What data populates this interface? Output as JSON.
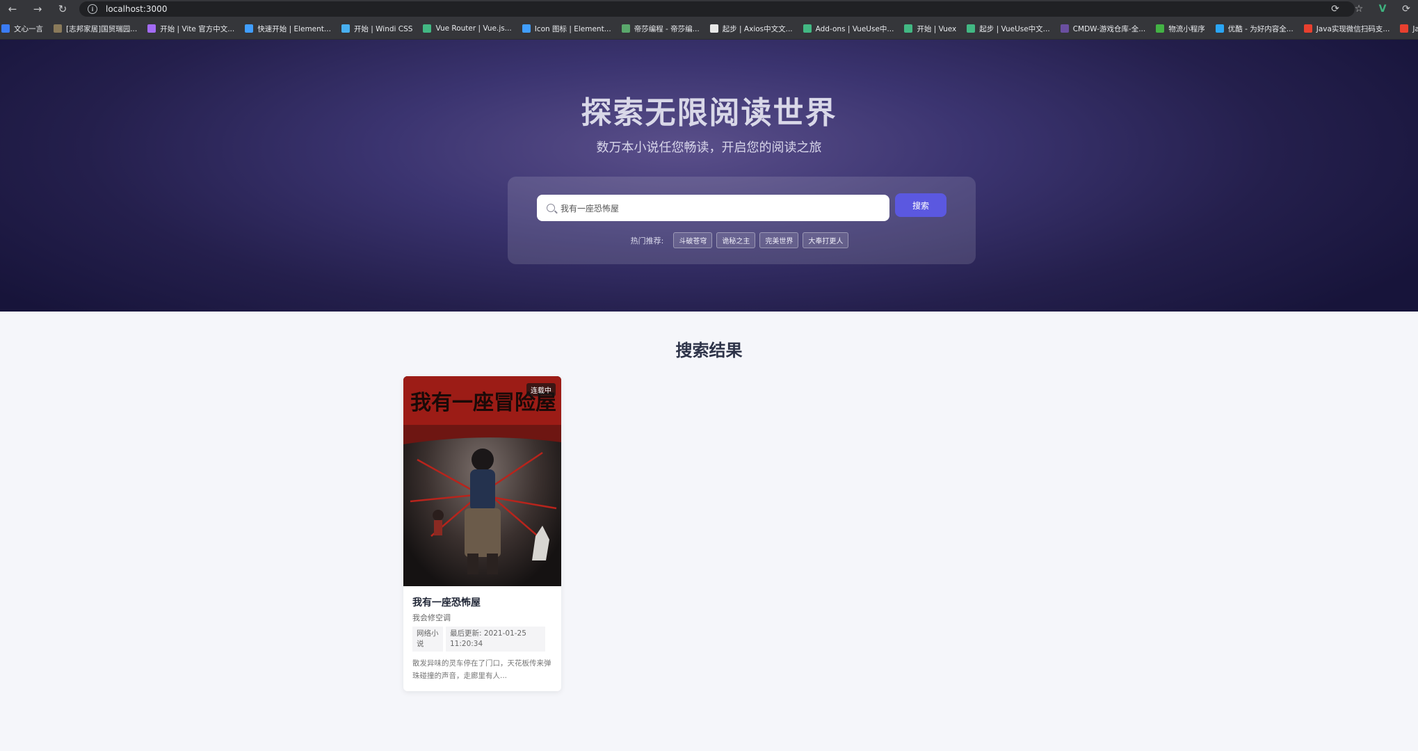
{
  "browser": {
    "url": "localhost:3000",
    "bookmarks": [
      {
        "label": "文心一言",
        "icon": "wenxin-icon",
        "color": "#3b7cf5"
      },
      {
        "label": "[志邦家居]国贸瑞园...",
        "icon": "bookmark-icon",
        "color": "#8a7a5a"
      },
      {
        "label": "开始 | Vite 官方中文...",
        "icon": "vite-icon",
        "color": "#a36bf5"
      },
      {
        "label": "快速开始 | Element...",
        "icon": "element-icon",
        "color": "#409eff"
      },
      {
        "label": "开始 | Windi CSS",
        "icon": "windi-icon",
        "color": "#48b0f1"
      },
      {
        "label": "Vue Router | Vue.js...",
        "icon": "vue-icon",
        "color": "#42b883"
      },
      {
        "label": "Icon 图标 | Element...",
        "icon": "element-icon",
        "color": "#409eff"
      },
      {
        "label": "帝莎编程 - 帝莎编...",
        "icon": "disha-icon",
        "color": "#5aa86c"
      },
      {
        "label": "起步 | Axios中文文...",
        "icon": "axios-icon",
        "color": "#e8e8e8"
      },
      {
        "label": "Add-ons | VueUse中...",
        "icon": "vueuse-icon",
        "color": "#42b883"
      },
      {
        "label": "开始 | Vuex",
        "icon": "vue-icon",
        "color": "#42b883"
      },
      {
        "label": "起步 | VueUse中文...",
        "icon": "vueuse-icon",
        "color": "#42b883"
      },
      {
        "label": "CMDW-游戏仓库-全...",
        "icon": "cmdw-icon",
        "color": "#6a4fa0"
      },
      {
        "label": "物流小程序",
        "icon": "wechat-icon",
        "color": "#43b244"
      },
      {
        "label": "优酷 - 为好内容全...",
        "icon": "youku-icon",
        "color": "#2aa5f5"
      },
      {
        "label": "Java实现微信扫码支...",
        "icon": "csdn-icon",
        "color": "#e8402f"
      },
      {
        "label": "Java--微信支付--小...",
        "icon": "csdn-icon",
        "color": "#e8402f"
      }
    ]
  },
  "hero": {
    "title": "探索无限阅读世界",
    "subtitle": "数万本小说任您畅读，开启您的阅读之旅",
    "search_value": "我有一座恐怖屋",
    "search_button": "搜索",
    "hot_label": "热门推荐:",
    "hot_tags": [
      "斗破苍穹",
      "诡秘之主",
      "完美世界",
      "大奉打更人"
    ]
  },
  "results": {
    "title": "搜索结果",
    "books": [
      {
        "cover_title": "我有一座冒险屋",
        "status": "连载中",
        "name": "我有一座恐怖屋",
        "author": "我会修空调",
        "category": "网络小说",
        "updated": "最后更新: 2021-01-25 11:20:34",
        "description": "散发异味的灵车停在了门口，天花板传来弹珠碰撞的声音，走廊里有人..."
      }
    ]
  }
}
